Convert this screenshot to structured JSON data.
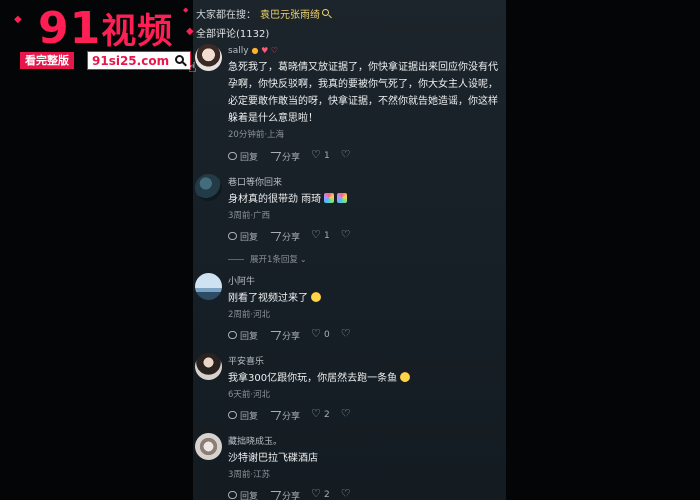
{
  "search": {
    "prefix": "大家都在搜：",
    "keyword": "袁巴元张雨绮"
  },
  "comments_header": "全部评论(1132)",
  "comments": [
    {
      "user": "sally",
      "text": "急死我了，葛晓倩又放证据了，你快拿证据出来回应你没有代孕啊，你快反驳啊，我真的要被你气死了，你大女主人设呢，必定要敢作敢当的呀，快拿证据，不然你就告她造谣，你这样躲着是什么意思啦！",
      "meta": "20分钟前·上海",
      "reply": "回复",
      "share": "分享",
      "likes": "1"
    },
    {
      "user": "巷口等你回来",
      "text": "身材真的很带劲 雨琦",
      "meta": "3周前·广西",
      "reply": "回复",
      "share": "分享",
      "likes": "1"
    },
    {
      "user": "小阿牛",
      "text": "刚看了视频过来了",
      "meta": "2周前·河北",
      "reply": "回复",
      "share": "分享",
      "likes": "0"
    },
    {
      "user": "平安喜乐",
      "text": "我拿300亿跟你玩，你居然去跑一条鱼",
      "meta": "6天前·河北",
      "reply": "回复",
      "share": "分享",
      "likes": "2"
    },
    {
      "user": "藏拙晓成玉。",
      "text": "沙特谢巴拉飞碟酒店",
      "meta": "3周前·江苏",
      "reply": "回复",
      "share": "分享",
      "likes": "2"
    }
  ],
  "expand_replies": "展开1条回复",
  "watermark": {
    "logo_num": "91",
    "logo_text": "视频",
    "badge": "看完整版",
    "url": "91si25.com"
  }
}
